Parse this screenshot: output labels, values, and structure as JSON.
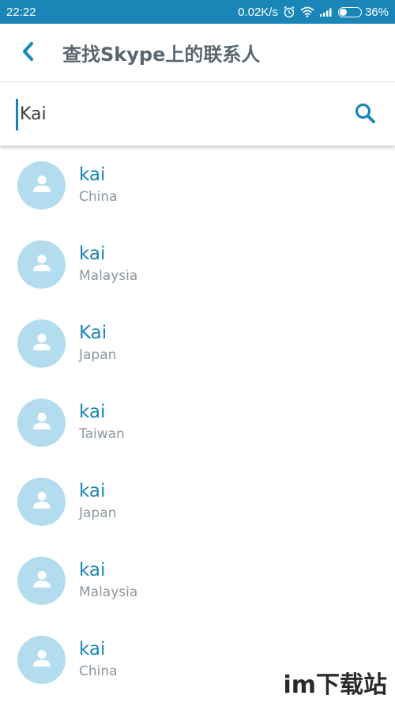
{
  "status_bar": {
    "time": "22:22",
    "network_speed": "0.02K/s",
    "battery_percent": "36%",
    "battery_level": 0.36,
    "icons": [
      "alarm-icon",
      "wifi-icon",
      "signal-icon",
      "battery-icon"
    ]
  },
  "app_bar": {
    "title": "查找Skype上的联系人",
    "back_icon": "chevron-left-icon"
  },
  "search": {
    "value": "Kai",
    "icon": "search-icon"
  },
  "results": [
    {
      "name": "kai",
      "country": "China"
    },
    {
      "name": "kai",
      "country": "Malaysia"
    },
    {
      "name": "Kai",
      "country": "Japan"
    },
    {
      "name": "kai",
      "country": "Taiwan"
    },
    {
      "name": "kai",
      "country": "Japan"
    },
    {
      "name": "kai",
      "country": "Malaysia"
    },
    {
      "name": "kai",
      "country": "China"
    }
  ],
  "watermark": "im下载站",
  "colors": {
    "status_bar": "#1a86b8",
    "accent": "#1a86b8",
    "avatar_bg": "#b3dcef",
    "secondary_text": "#8d979e"
  }
}
